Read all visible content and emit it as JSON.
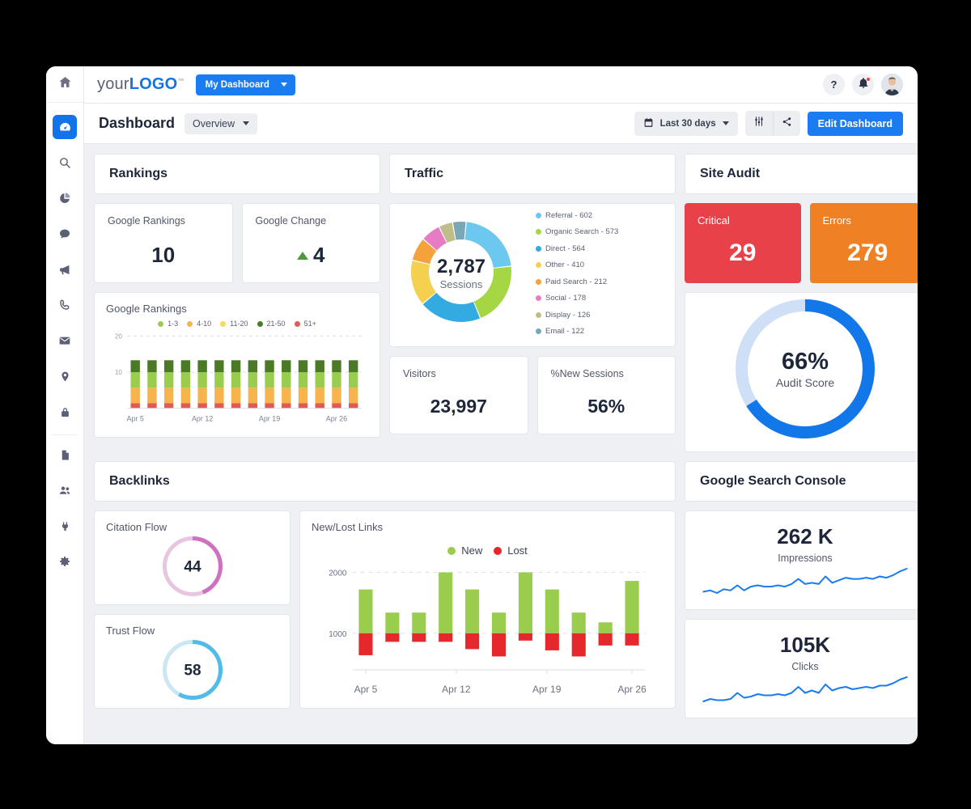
{
  "topbar": {
    "logo_pre": "your",
    "logo_bold": "LOGO",
    "logo_tm": "™",
    "dashboard_pill": "My Dashboard",
    "help_label": "?",
    "icons": [
      "help-icon",
      "bell-icon",
      "avatar"
    ]
  },
  "pageheader": {
    "title": "Dashboard",
    "overview_label": "Overview",
    "date_range": "Last 30 days",
    "edit_label": "Edit Dashboard",
    "filter_icon": "sliders-icon",
    "share_icon": "share-icon",
    "calendar_icon": "calendar-icon"
  },
  "sidebar": {
    "items": [
      {
        "name": "home",
        "label": "Home"
      },
      {
        "name": "dashboard",
        "label": "Dashboard",
        "active": true
      },
      {
        "name": "search",
        "label": "Search"
      },
      {
        "name": "analytics",
        "label": "Analytics"
      },
      {
        "name": "chat",
        "label": "Chat"
      },
      {
        "name": "campaigns",
        "label": "Campaigns"
      },
      {
        "name": "calls",
        "label": "Calls"
      },
      {
        "name": "email",
        "label": "Email"
      },
      {
        "name": "locations",
        "label": "Locations"
      },
      {
        "name": "security",
        "label": "Security"
      },
      {
        "name": "reports",
        "label": "Reports"
      },
      {
        "name": "users",
        "label": "Users"
      },
      {
        "name": "integrations",
        "label": "Integrations"
      },
      {
        "name": "settings",
        "label": "Settings"
      }
    ]
  },
  "sections": {
    "rankings": "Rankings",
    "traffic": "Traffic",
    "site_audit": "Site Audit",
    "backlinks": "Backlinks",
    "search_console": "Google Search Console"
  },
  "rankings": {
    "google_rankings_label": "Google Rankings",
    "google_rankings_value": "10",
    "google_change_label": "Google Change",
    "google_change_value": "4",
    "google_change_direction": "up"
  },
  "traffic": {
    "total": "2,787",
    "total_label": "Sessions",
    "visitors_label": "Visitors",
    "visitors_value": "23,997",
    "new_sessions_label": "%New Sessions",
    "new_sessions_value": "56%"
  },
  "site_audit": {
    "critical_label": "Critical",
    "critical_value": "29",
    "critical_color": "#e8414a",
    "errors_label": "Errors",
    "errors_value": "279",
    "errors_color": "#ef8024",
    "score_value": "66%",
    "score_label": "Audit Score",
    "score_color": "#1277e8",
    "score_track": "#cfe0f6"
  },
  "backlinks": {
    "citation_flow_label": "Citation Flow",
    "citation_flow_value": "44",
    "citation_flow_color": "#d070c0",
    "citation_flow_track": "#e8c6e0",
    "trust_flow_label": "Trust Flow",
    "trust_flow_value": "58",
    "trust_flow_color": "#52bbe8",
    "trust_flow_track": "#cbe7f5"
  },
  "search_console": {
    "impressions_value": "262 K",
    "impressions_label": "Impressions",
    "clicks_value": "105K",
    "clicks_label": "Clicks",
    "line_color": "#1a7cf0"
  },
  "chart_data": [
    {
      "id": "traffic-donut",
      "type": "pie",
      "title": "Traffic",
      "center_value": "2,787",
      "center_label": "Sessions",
      "legend_position": "right",
      "categories": [
        "Referral",
        "Organic Search",
        "Direct",
        "Other",
        "Paid Search",
        "Social",
        "Display",
        "Email"
      ],
      "values": [
        602,
        573,
        564,
        410,
        212,
        178,
        126,
        122
      ],
      "colors": [
        "#6dc8f0",
        "#a5d644",
        "#33aae0",
        "#f5cf4e",
        "#f5a23c",
        "#e87cc4",
        "#bfbd8a",
        "#7ba7b5"
      ],
      "labels": [
        "Referral - 602",
        "Organic Search - 573",
        "Direct - 564",
        "Other - 410",
        "Paid Search - 212",
        "Social - 178",
        "Display - 126",
        "Email - 122"
      ]
    },
    {
      "id": "google-rankings-bars",
      "type": "bar",
      "title": "Google Rankings",
      "stacked": true,
      "xlabel": "",
      "ylabel": "",
      "ylim": [
        0,
        20
      ],
      "yticks": [
        10,
        20
      ],
      "grid": true,
      "xticks": [
        "Apr 5",
        "Apr 12",
        "Apr 19",
        "Apr 26"
      ],
      "xtick_positions": [
        0,
        4,
        8,
        12
      ],
      "legend": [
        "1-3",
        "4-10",
        "11-20",
        "21-50",
        "51+"
      ],
      "legend_colors": [
        "#9acd4e",
        "#f7b44c",
        "#f8d95f",
        "#4a7a26",
        "#e05a56"
      ],
      "series": [
        {
          "name": "51+",
          "color": "#e05a56",
          "values": [
            1.4,
            1.4,
            1.4,
            1.4,
            1.4,
            1.4,
            1.4,
            1.4,
            1.4,
            1.4,
            1.4,
            1.4,
            1.4,
            1.4
          ]
        },
        {
          "name": "4-10",
          "color": "#f7b44c",
          "values": [
            4.3,
            4.3,
            4.3,
            4.3,
            4.3,
            4.3,
            4.3,
            4.3,
            4.3,
            4.3,
            4.3,
            4.3,
            4.3,
            4.3
          ]
        },
        {
          "name": "1-3",
          "color": "#9acd4e",
          "values": [
            4.3,
            4.3,
            4.3,
            4.3,
            4.3,
            4.3,
            4.3,
            4.3,
            4.3,
            4.3,
            4.3,
            4.3,
            4.3,
            4.3
          ]
        },
        {
          "name": "21-50",
          "color": "#4a7a26",
          "values": [
            3.3,
            3.3,
            3.3,
            3.3,
            3.3,
            3.3,
            3.3,
            3.3,
            3.3,
            3.3,
            3.3,
            3.3,
            3.3,
            3.3
          ]
        }
      ]
    },
    {
      "id": "new-lost-links",
      "type": "bar",
      "title": "New/Lost Links",
      "baseline": 1000,
      "ylim": [
        400,
        2100
      ],
      "yticks": [
        1000,
        2000
      ],
      "grid": true,
      "xticks": [
        "Apr 5",
        "Apr 12",
        "Apr 19",
        "Apr 26"
      ],
      "legend": [
        "New",
        "Lost"
      ],
      "legend_colors": [
        "#9acd4e",
        "#e5282c"
      ],
      "series": [
        {
          "name": "New",
          "color": "#9acd4e",
          "values": [
            1720,
            1340,
            1340,
            2000,
            1720,
            1340,
            2000,
            1720,
            1340,
            1180,
            1860
          ]
        },
        {
          "name": "Lost",
          "color": "#e5282c",
          "values": [
            640,
            860,
            860,
            860,
            740,
            620,
            880,
            720,
            620,
            800,
            800
          ]
        }
      ]
    },
    {
      "id": "impressions-spark",
      "type": "line",
      "title": "Impressions",
      "color": "#1a7cf0",
      "values": [
        8,
        9,
        7,
        10,
        9,
        13,
        9,
        12,
        13,
        12,
        12,
        13,
        12,
        14,
        18,
        14,
        15,
        14,
        20,
        15,
        17,
        19,
        18,
        18,
        19,
        18,
        20,
        19,
        21,
        24,
        26
      ]
    },
    {
      "id": "clicks-spark",
      "type": "line",
      "title": "Clicks",
      "color": "#1a7cf0",
      "values": [
        7,
        9,
        8,
        8,
        9,
        14,
        10,
        11,
        13,
        12,
        12,
        13,
        12,
        14,
        19,
        14,
        16,
        14,
        21,
        16,
        18,
        19,
        17,
        18,
        19,
        18,
        20,
        20,
        22,
        25,
        27
      ]
    }
  ]
}
